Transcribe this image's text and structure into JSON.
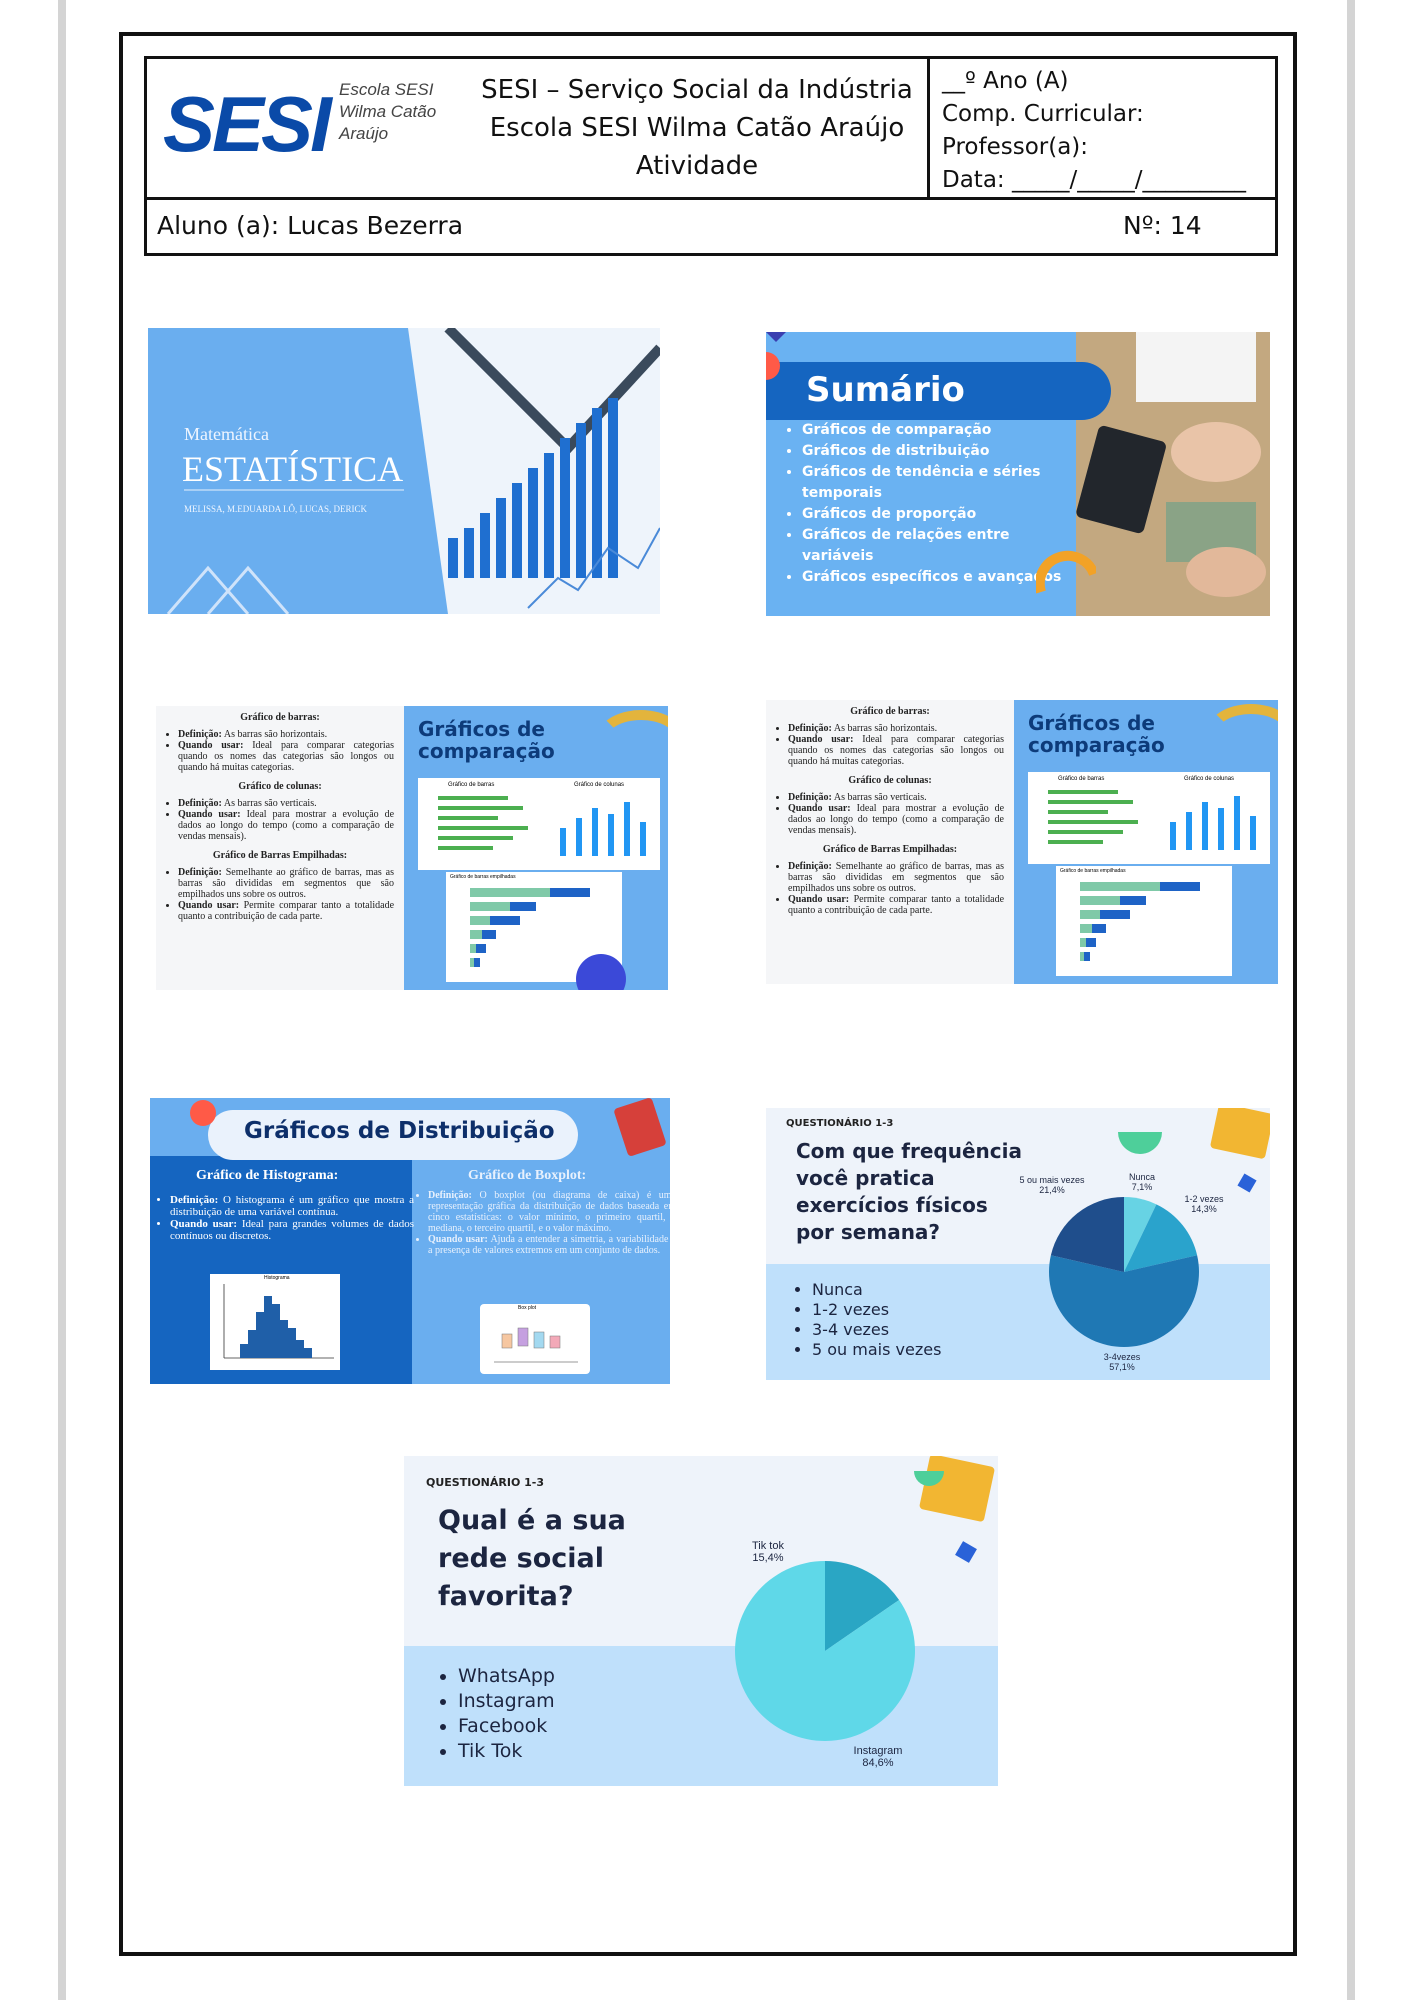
{
  "header": {
    "logo_text": "SESI",
    "logo_sub": [
      "Escola SESI",
      "Wilma Catão",
      "Araújo"
    ],
    "institution_lines": [
      "SESI – Serviço Social da Indústria",
      "Escola SESI Wilma Catão Araújo",
      "Atividade"
    ],
    "right_lines": [
      "__º Ano (A)",
      "Comp. Curricular:",
      "Professor(a):",
      "Data: _____/_____/_________"
    ],
    "student": "Aluno (a): Lucas Bezerra",
    "number": "Nº: 14"
  },
  "slide1": {
    "subject": "Matemática",
    "title": "ESTATÍSTICA",
    "authors": "MELISSA, M.EDUARDA LÔ, LUCAS, DERICK"
  },
  "slide2": {
    "title": "Sumário",
    "items": [
      "Gráficos de comparação",
      "Gráficos de distribuição",
      "Gráficos de tendência e séries temporais",
      "Gráficos de proporção",
      "Gráficos de relações entre variáveis",
      "Gráficos específicos e avançados"
    ]
  },
  "comparison": {
    "title": "Gráficos de comparação",
    "bar_heading": "Gráfico de barras:",
    "bar_def_label": "Definição:",
    "bar_def": "As barras são horizontais.",
    "bar_use_label": "Quando usar:",
    "bar_use": "Ideal para comparar categorias quando os nomes das categorias são longos ou quando há muitas categorias.",
    "col_heading": "Gráfico de colunas:",
    "col_def_label": "Definição:",
    "col_def": "As barras são verticais.",
    "col_use_label": "Quando usar:",
    "col_use": "Ideal para mostrar a evolução de dados ao longo do tempo (como a comparação de vendas mensais).",
    "stack_heading": "Gráfico de Barras Empilhadas:",
    "stack_def_label": "Definição:",
    "stack_def": "Semelhante ao gráfico de barras, mas as barras são divididas em segmentos que são empilhados uns sobre os outros.",
    "stack_use_label": "Quando usar:",
    "stack_use": "Permite comparar tanto a totalidade quanto a contribuição de cada parte.",
    "mini_bar_title": "Gráfico de barras",
    "mini_col_title": "Gráfico de colunas",
    "mini_stack_title": "Gráfico de barras empilhadas"
  },
  "distribution": {
    "title": "Gráficos de Distribuição",
    "hist_heading": "Gráfico de Histograma:",
    "hist_def_label": "Definição:",
    "hist_def": "O histograma é um gráfico que mostra a distribuição de uma variável contínua.",
    "hist_use_label": "Quando usar:",
    "hist_use": "Ideal para grandes volumes de dados contínuos ou discretos.",
    "hist_chart_title": "Histograma",
    "box_heading": "Gráfico de Boxplot:",
    "box_def_label": "Definição:",
    "box_def": "O boxplot (ou diagrama de caixa) é uma representação gráfica da distribuição de dados baseada em cinco estatísticas: o valor mínimo, o primeiro quartil, a mediana, o terceiro quartil, e o valor máximo.",
    "box_use_label": "Quando usar:",
    "box_use": "Ajuda a entender a simetria, a variabilidade e a presença de valores extremos em um conjunto de dados.",
    "box_chart_title": "Box plot"
  },
  "survey1": {
    "tag": "QUESTIONÁRIO 1-3",
    "question": "Com que frequência você pratica exercícios físicos por semana?",
    "options": [
      "Nunca",
      "1-2 vezes",
      "3-4 vezes",
      "5 ou mais vezes"
    ],
    "labels": [
      {
        "name": "Nunca",
        "pct": "7,1%"
      },
      {
        "name": "1-2 vezes",
        "pct": "14,3%"
      },
      {
        "name": "3-4vezes",
        "pct": "57,1%"
      },
      {
        "name": "5 ou mais vezes",
        "pct": "21,4%"
      }
    ]
  },
  "survey2": {
    "tag": "QUESTIONÁRIO 1-3",
    "question": "Qual é a sua rede social favorita?",
    "options": [
      "WhatsApp",
      "Instagram",
      "Facebook",
      "Tik Tok"
    ],
    "labels": [
      {
        "name": "Tik tok",
        "pct": "15,4%"
      },
      {
        "name": "Instagram",
        "pct": "84,6%"
      }
    ]
  },
  "chart_data": [
    {
      "type": "pie",
      "title": "",
      "categories": [
        "Nunca",
        "1-2 vezes",
        "3-4vezes",
        "5 ou mais vezes"
      ],
      "values": [
        7.1,
        14.3,
        57.1,
        21.4
      ],
      "colors": [
        "#67d3e4",
        "#2aa3cc",
        "#1f78b4",
        "#1f4e8c"
      ]
    },
    {
      "type": "pie",
      "title": "",
      "categories": [
        "Tik tok",
        "Instagram"
      ],
      "values": [
        15.4,
        84.6
      ],
      "colors": [
        "#2aa6c4",
        "#5fd8e8"
      ]
    }
  ]
}
